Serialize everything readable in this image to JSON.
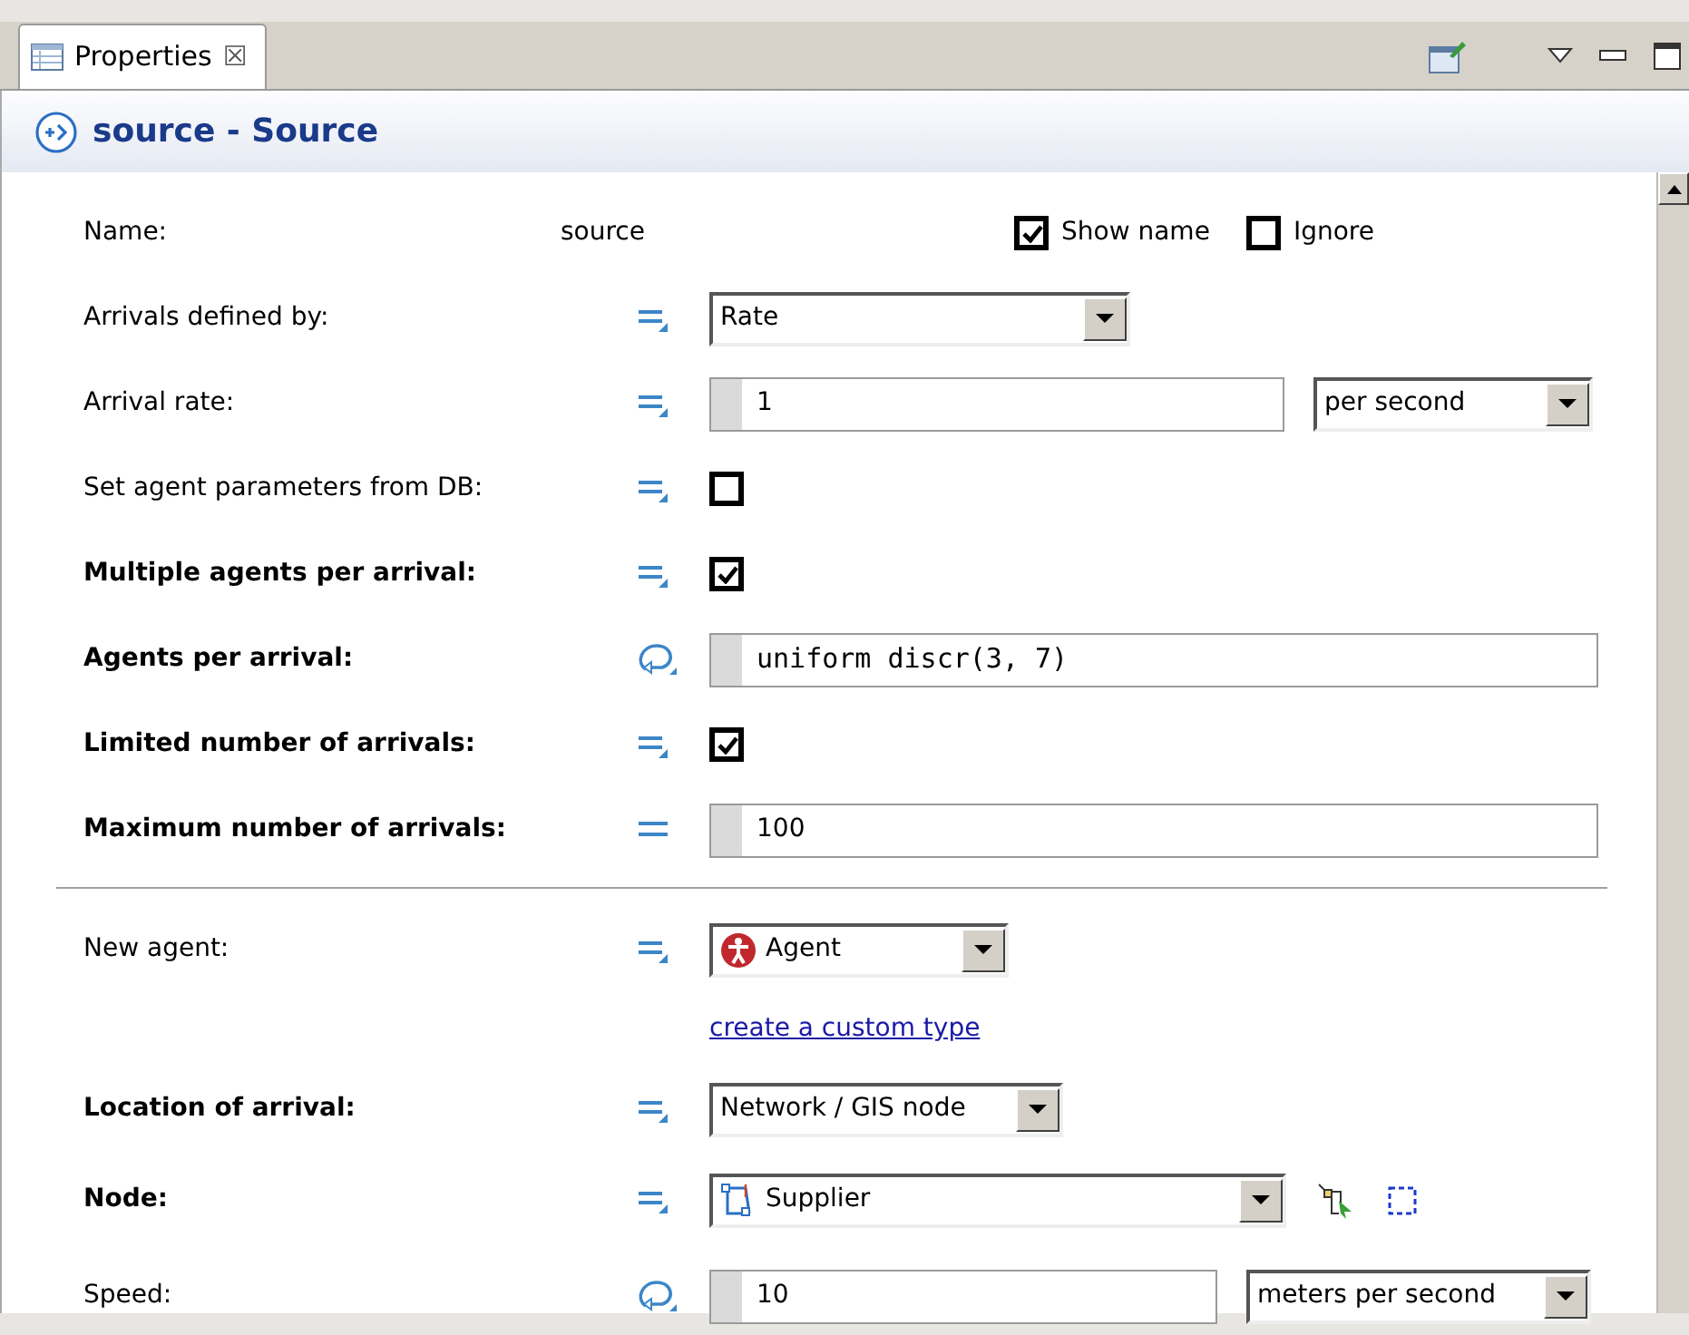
{
  "tab": {
    "title": "Properties",
    "close": "☒"
  },
  "header": {
    "title": "source - Source"
  },
  "name_row": {
    "label": "Name:",
    "value": "source",
    "options": [
      {
        "label": "Show name",
        "checked": true
      },
      {
        "label": "Ignore",
        "checked": false
      }
    ]
  },
  "sections": [
    {
      "rows": [
        {
          "label": "Arrivals defined by:",
          "bold": false,
          "kind": "dropdown",
          "value": "Rate"
        },
        {
          "label": "Arrival rate:",
          "bold": false,
          "kind": "field",
          "value": "1",
          "unit": "per second"
        },
        {
          "label": "Set agent parameters from DB:",
          "bold": false,
          "kind": "checkbox",
          "checked": false
        },
        {
          "label": "Multiple agents per arrival:",
          "bold": true,
          "kind": "checkbox",
          "checked": true
        },
        {
          "label": "Agents per arrival:",
          "bold": true,
          "kind": "code",
          "value": "uniform discr(3, 7)"
        },
        {
          "label": "Limited number of arrivals:",
          "bold": true,
          "kind": "checkbox",
          "checked": true
        },
        {
          "label": "Maximum number of arrivals:",
          "bold": true,
          "kind": "field",
          "value": "100"
        }
      ]
    },
    {
      "rows": [
        {
          "label": "New agent:",
          "bold": false,
          "kind": "agent-dropdown",
          "value": "Agent"
        },
        {
          "kind": "link",
          "value": "create a custom type"
        },
        {
          "label": "Location of arrival:",
          "bold": true,
          "kind": "dropdown",
          "value": "Network / GIS node"
        },
        {
          "label": "Node:",
          "bold": true,
          "kind": "node-dropdown",
          "value": "Supplier"
        },
        {
          "label": "Speed:",
          "bold": false,
          "kind": "field",
          "value": "10",
          "unit": "meters per second"
        }
      ]
    }
  ]
}
